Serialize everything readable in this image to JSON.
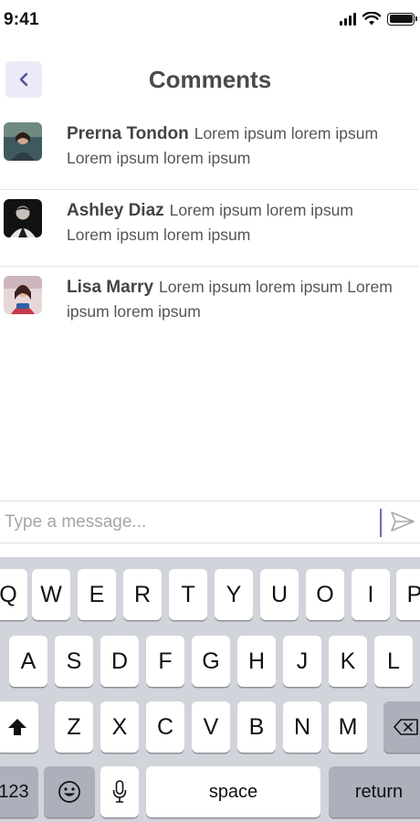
{
  "status_bar": {
    "time": "9:41"
  },
  "header": {
    "title": "Comments"
  },
  "comments": [
    {
      "author": "Prerna Tondon",
      "text": "Lorem ipsum lorem ipsum Lorem ipsum lorem ipsum"
    },
    {
      "author": "Ashley Diaz",
      "text": "Lorem ipsum lorem ipsum Lorem ipsum lorem ipsum"
    },
    {
      "author": "Lisa Marry",
      "text": "Lorem ipsum lorem ipsum Lorem ipsum lorem ipsum"
    }
  ],
  "composer": {
    "placeholder": "Type a message..."
  },
  "keyboard": {
    "row1": [
      "Q",
      "W",
      "E",
      "R",
      "T",
      "Y",
      "U",
      "O",
      "I",
      "P"
    ],
    "row2": [
      "A",
      "S",
      "D",
      "F",
      "G",
      "H",
      "J",
      "K",
      "L"
    ],
    "row3": [
      "Z",
      "X",
      "C",
      "V",
      "B",
      "N",
      "M"
    ],
    "numbers_label": "123",
    "space_label": "space",
    "return_label": "return"
  },
  "colors": {
    "accent": "#6a6fb5",
    "back_button_bg": "#eceaf6",
    "keyboard_bg": "#d1d4da"
  }
}
